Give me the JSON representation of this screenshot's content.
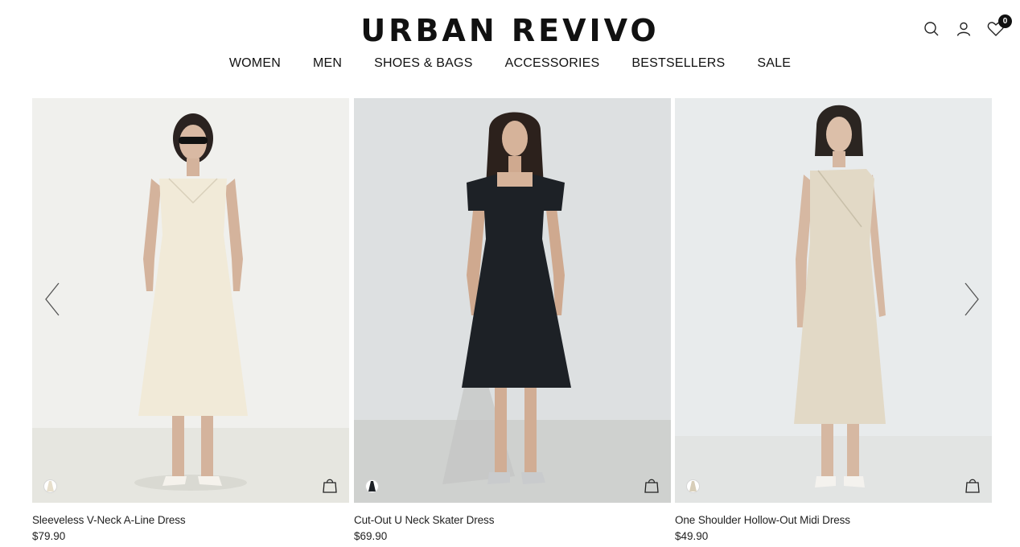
{
  "brand": {
    "logo_text": "URBAN REVIVO"
  },
  "header": {
    "icons": [
      "search-icon",
      "account-icon",
      "wishlist-icon"
    ],
    "wishlist_count": "0"
  },
  "nav": {
    "items": [
      "WOMEN",
      "MEN",
      "SHOES & BAGS",
      "ACCESSORIES",
      "BESTSELLERS",
      "SALE"
    ]
  },
  "products": [
    {
      "name": "Sleeveless V-Neck A-Line Dress",
      "price": "$79.90",
      "dress_color": "#f1ead8",
      "bg": "#efefec"
    },
    {
      "name": "Cut-Out U Neck Skater Dress",
      "price": "$69.90",
      "dress_color": "#1d2126",
      "bg": "#dfe2e3"
    },
    {
      "name": "One Shoulder Hollow-Out Midi Dress",
      "price": "$49.90",
      "dress_color": "#e2d9c6",
      "bg": "#e9eced"
    }
  ],
  "carousel": {
    "prev_icon": "chevron-left-icon",
    "next_icon": "chevron-right-icon"
  }
}
